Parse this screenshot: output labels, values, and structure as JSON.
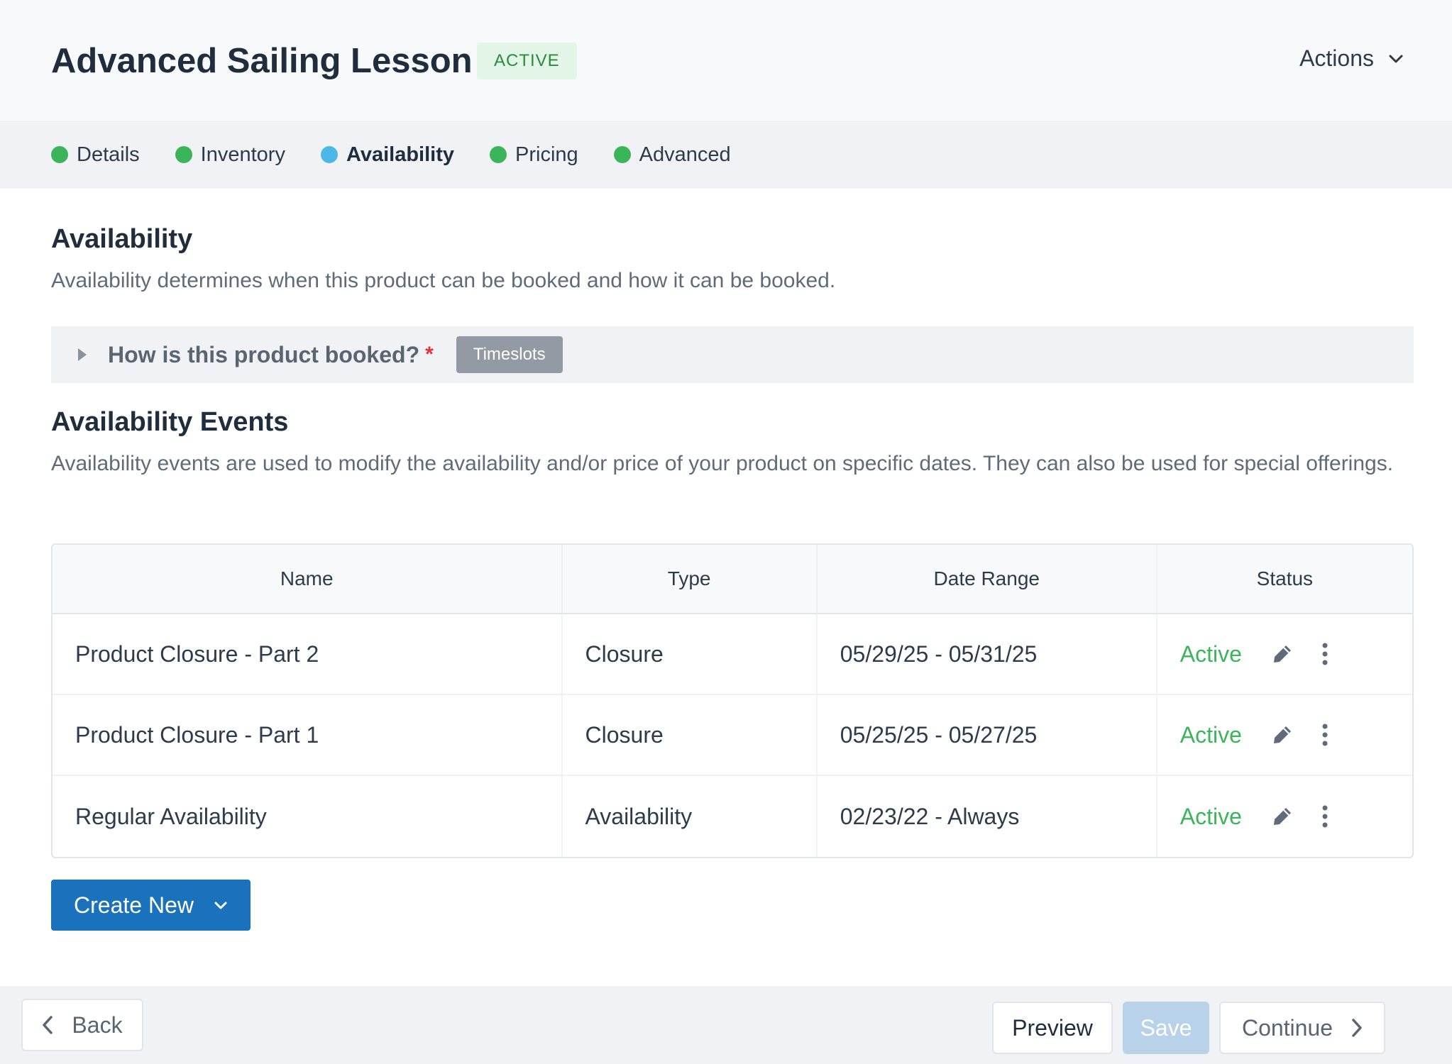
{
  "header": {
    "title": "Advanced Sailing Lesson",
    "status": "ACTIVE",
    "actions_label": "Actions"
  },
  "steps": [
    {
      "label": "Details",
      "state": "complete",
      "color": "#3cb55a"
    },
    {
      "label": "Inventory",
      "state": "complete",
      "color": "#3cb55a"
    },
    {
      "label": "Availability",
      "state": "current",
      "color": "#4cb8ea"
    },
    {
      "label": "Pricing",
      "state": "complete",
      "color": "#3cb55a"
    },
    {
      "label": "Advanced",
      "state": "complete",
      "color": "#3cb55a"
    }
  ],
  "availability": {
    "title": "Availability",
    "description": "Availability determines when this product can be booked and how it can be booked."
  },
  "booking": {
    "question": "How is this product booked?",
    "required_mark": "*",
    "value": "Timeslots"
  },
  "events": {
    "title": "Availability Events",
    "description": "Availability events are used to modify the availability and/or price of your product on specific dates. They can also be used for special offerings.",
    "columns": [
      "Name",
      "Type",
      "Date Range",
      "Status"
    ],
    "rows": [
      {
        "name": "Product Closure - Part 2",
        "type": "Closure",
        "date_range": "05/29/25 - 05/31/25",
        "status": "Active"
      },
      {
        "name": "Product Closure - Part 1",
        "type": "Closure",
        "date_range": "05/25/25 - 05/27/25",
        "status": "Active"
      },
      {
        "name": "Regular Availability",
        "type": "Availability",
        "date_range": "02/23/22 - Always",
        "status": "Active"
      }
    ],
    "create_new_label": "Create New"
  },
  "footer": {
    "back_label": "Back",
    "preview_label": "Preview",
    "save_label": "Save",
    "continue_label": "Continue"
  },
  "colors": {
    "primary": "#1a72bd",
    "active_green": "#3cb55a",
    "current_step": "#4cb8ea",
    "save_disabled": "#b8d2ea"
  }
}
